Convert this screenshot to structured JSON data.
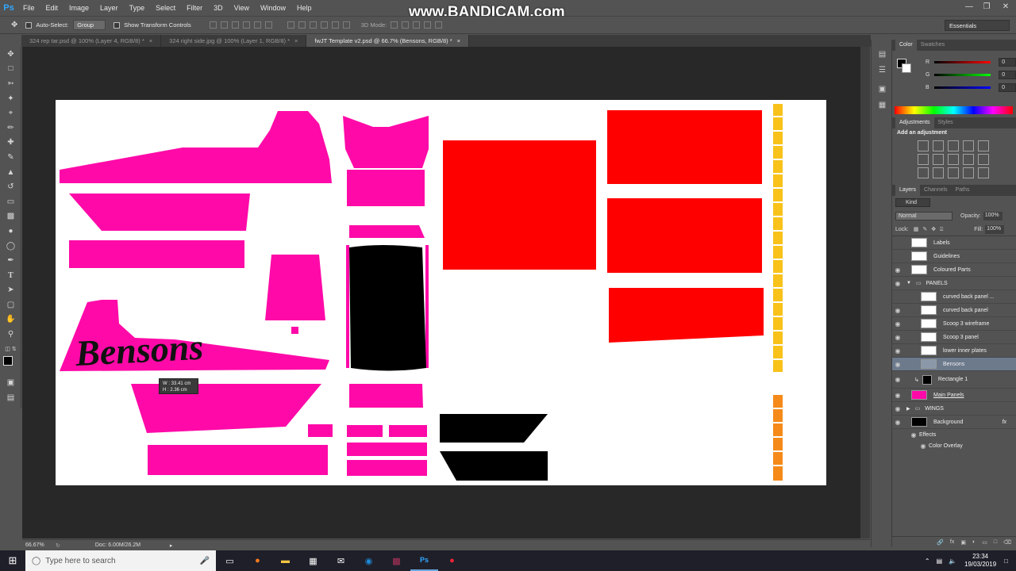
{
  "app": {
    "logo": "Ps",
    "watermark": "www.BANDICAM.com"
  },
  "menu": [
    "File",
    "Edit",
    "Image",
    "Layer",
    "Type",
    "Select",
    "Filter",
    "3D",
    "View",
    "Window",
    "Help"
  ],
  "options": {
    "auto_select_label": "Auto-Select:",
    "auto_select_value": "Group",
    "show_transform_label": "Show Transform Controls",
    "mode_3d": "3D Mode:",
    "workspace": "Essentials"
  },
  "tabs": [
    {
      "label": "324 rep tar.psd @ 100% (Layer 4, RGB/8) *"
    },
    {
      "label": "324 right side.jpg @ 100% (Layer 1, RGB/8) *"
    },
    {
      "label": "fwJT Template v2.psd @ 66.7% (Bensons, RGB/8) *"
    }
  ],
  "canvas": {
    "logo_text": "Bensons",
    "measure_w": "W : 33.41 cm",
    "measure_h": "H : 2.36 cm",
    "colors": {
      "pink": "#ff0aa8",
      "red": "#ff0000",
      "black": "#000000",
      "yellow": "#f8c21a",
      "orange": "#f58a1a"
    }
  },
  "status": {
    "zoom": "66.67%",
    "doc": "Doc: 6.00M/26.2M"
  },
  "color_panel": {
    "tabs": [
      "Color",
      "Swatches"
    ],
    "channels": [
      {
        "label": "R",
        "value": "0"
      },
      {
        "label": "G",
        "value": "0"
      },
      {
        "label": "B",
        "value": "0"
      }
    ]
  },
  "adjustments": {
    "tabs": [
      "Adjustments",
      "Styles"
    ],
    "title": "Add an adjustment"
  },
  "layers_panel": {
    "tabs": [
      "Layers",
      "Channels",
      "Paths"
    ],
    "kind": "Kind",
    "blend_mode": "Normal",
    "opacity_label": "Opacity:",
    "opacity": "100%",
    "lock_label": "Lock:",
    "fill_label": "Fill:",
    "fill": "100%",
    "layers": [
      {
        "name": "Labels",
        "visible": false
      },
      {
        "name": "Guidelines",
        "visible": false
      },
      {
        "name": "Coloured Parts",
        "visible": true
      },
      {
        "name": "PANELS",
        "visible": true,
        "group": true
      },
      {
        "name": "curved back panel ...",
        "visible": false
      },
      {
        "name": "curved back panel",
        "visible": true
      },
      {
        "name": "Scoop 3 wireframe",
        "visible": true
      },
      {
        "name": "Scoop 3 panel",
        "visible": true
      },
      {
        "name": "lower inner plates",
        "visible": true
      },
      {
        "name": "Bensons",
        "visible": true,
        "selected": true
      },
      {
        "name": "Rectangle 1",
        "visible": true
      },
      {
        "name": "Main Panels",
        "visible": true
      },
      {
        "name": "WINGS",
        "visible": true,
        "group": true
      },
      {
        "name": "Background",
        "visible": true
      },
      {
        "name": "Effects",
        "visible": false,
        "sub": true
      },
      {
        "name": "Color Overlay",
        "visible": false,
        "sub": true
      }
    ]
  },
  "taskbar": {
    "search_placeholder": "Type here to search",
    "time": "23:34",
    "date": "19/03/2019"
  }
}
